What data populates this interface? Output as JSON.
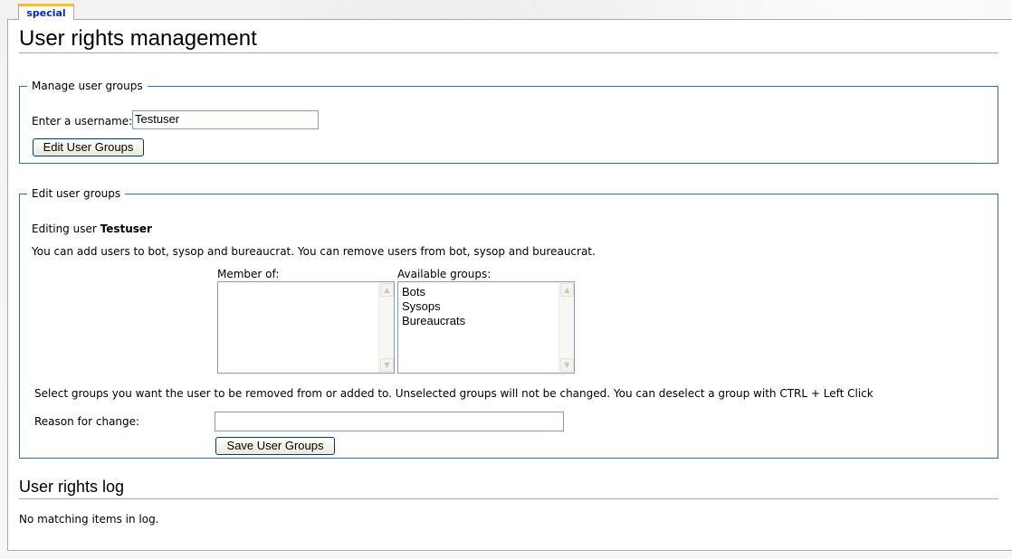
{
  "tab": {
    "label": "special"
  },
  "page": {
    "title": "User rights management"
  },
  "manage_groups": {
    "legend": "Manage user groups",
    "username_label": "Enter a username:",
    "username_value": "Testuser",
    "button_label": "Edit User Groups"
  },
  "edit_groups": {
    "legend": "Edit user groups",
    "editing_prefix": "Editing user ",
    "editing_user": "Testuser",
    "permissions_text": "You can add users to bot, sysop and bureaucrat. You can remove users from bot, sysop and bureaucrat.",
    "member_of_label": "Member of:",
    "member_of_items": [],
    "available_label": "Available groups:",
    "available_items": [
      "Bots",
      "Sysops",
      "Bureaucrats"
    ],
    "instructions": "Select groups you want the user to be removed from or added to. Unselected groups will not be changed. You can deselect a group with CTRL + Left Click",
    "reason_label": "Reason for change:",
    "reason_value": "",
    "save_label": "Save User Groups"
  },
  "log": {
    "title": "User rights log",
    "empty_text": "No matching items in log."
  },
  "colors": {
    "fieldset_border": "#2f6fab",
    "tab_accent": "#fabd23",
    "tab_text": "#002bb8"
  }
}
